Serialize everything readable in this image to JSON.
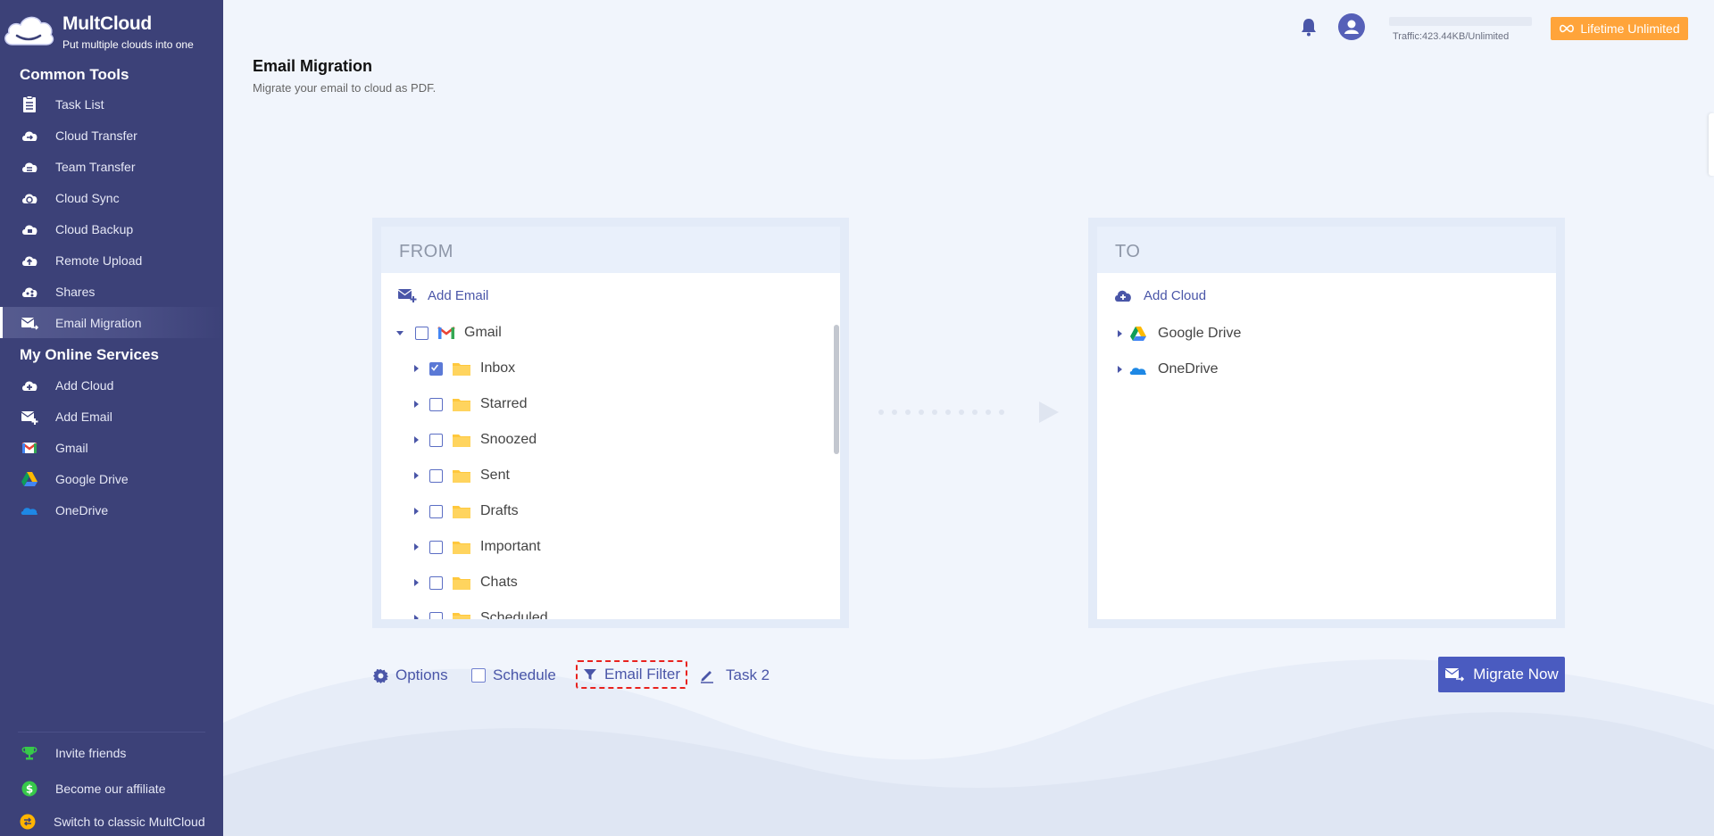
{
  "brand": {
    "name": "MultCloud",
    "tagline": "Put multiple clouds into one"
  },
  "sidebar": {
    "common_tools_title": "Common Tools",
    "common_tools": [
      {
        "label": "Task List",
        "icon": "task-list-icon"
      },
      {
        "label": "Cloud Transfer",
        "icon": "cloud-transfer-icon"
      },
      {
        "label": "Team Transfer",
        "icon": "team-transfer-icon"
      },
      {
        "label": "Cloud Sync",
        "icon": "cloud-sync-icon"
      },
      {
        "label": "Cloud Backup",
        "icon": "cloud-backup-icon"
      },
      {
        "label": "Remote Upload",
        "icon": "remote-upload-icon"
      },
      {
        "label": "Shares",
        "icon": "shares-icon"
      },
      {
        "label": "Email Migration",
        "icon": "email-migration-icon",
        "active": true
      }
    ],
    "services_title": "My Online Services",
    "services": [
      {
        "label": "Add Cloud",
        "icon": "add-cloud-icon"
      },
      {
        "label": "Add Email",
        "icon": "add-email-icon"
      },
      {
        "label": "Gmail",
        "icon": "gmail-icon"
      },
      {
        "label": "Google Drive",
        "icon": "google-drive-icon"
      },
      {
        "label": "OneDrive",
        "icon": "onedrive-icon"
      }
    ],
    "footer": [
      {
        "label": "Invite friends",
        "icon": "trophy-icon"
      },
      {
        "label": "Become our affiliate",
        "icon": "dollar-icon"
      },
      {
        "label": "Switch to classic MultCloud",
        "icon": "switch-icon"
      }
    ]
  },
  "header": {
    "traffic": "Traffic:423.44KB/Unlimited",
    "lifetime_label": "Lifetime Unlimited"
  },
  "page": {
    "title": "Email Migration",
    "subtitle": "Migrate your email to cloud as PDF."
  },
  "from_panel": {
    "title": "FROM",
    "add_label": "Add Email",
    "account": "Gmail",
    "folders": [
      {
        "label": "Inbox",
        "checked": true
      },
      {
        "label": "Starred",
        "checked": false
      },
      {
        "label": "Snoozed",
        "checked": false
      },
      {
        "label": "Sent",
        "checked": false
      },
      {
        "label": "Drafts",
        "checked": false
      },
      {
        "label": "Important",
        "checked": false
      },
      {
        "label": "Chats",
        "checked": false
      },
      {
        "label": "Scheduled",
        "checked": false
      }
    ]
  },
  "to_panel": {
    "title": "TO",
    "add_label": "Add Cloud",
    "clouds": [
      "Google Drive",
      "OneDrive"
    ]
  },
  "toolbar": {
    "options": "Options",
    "schedule": "Schedule",
    "email_filter": "Email Filter",
    "task_name": "Task 2",
    "migrate": "Migrate Now"
  },
  "colors": {
    "sidebar_bg": "#3c4178",
    "accent": "#4a5bc0",
    "lifetime": "#ffa43a",
    "filter_outline": "#e8221e"
  }
}
